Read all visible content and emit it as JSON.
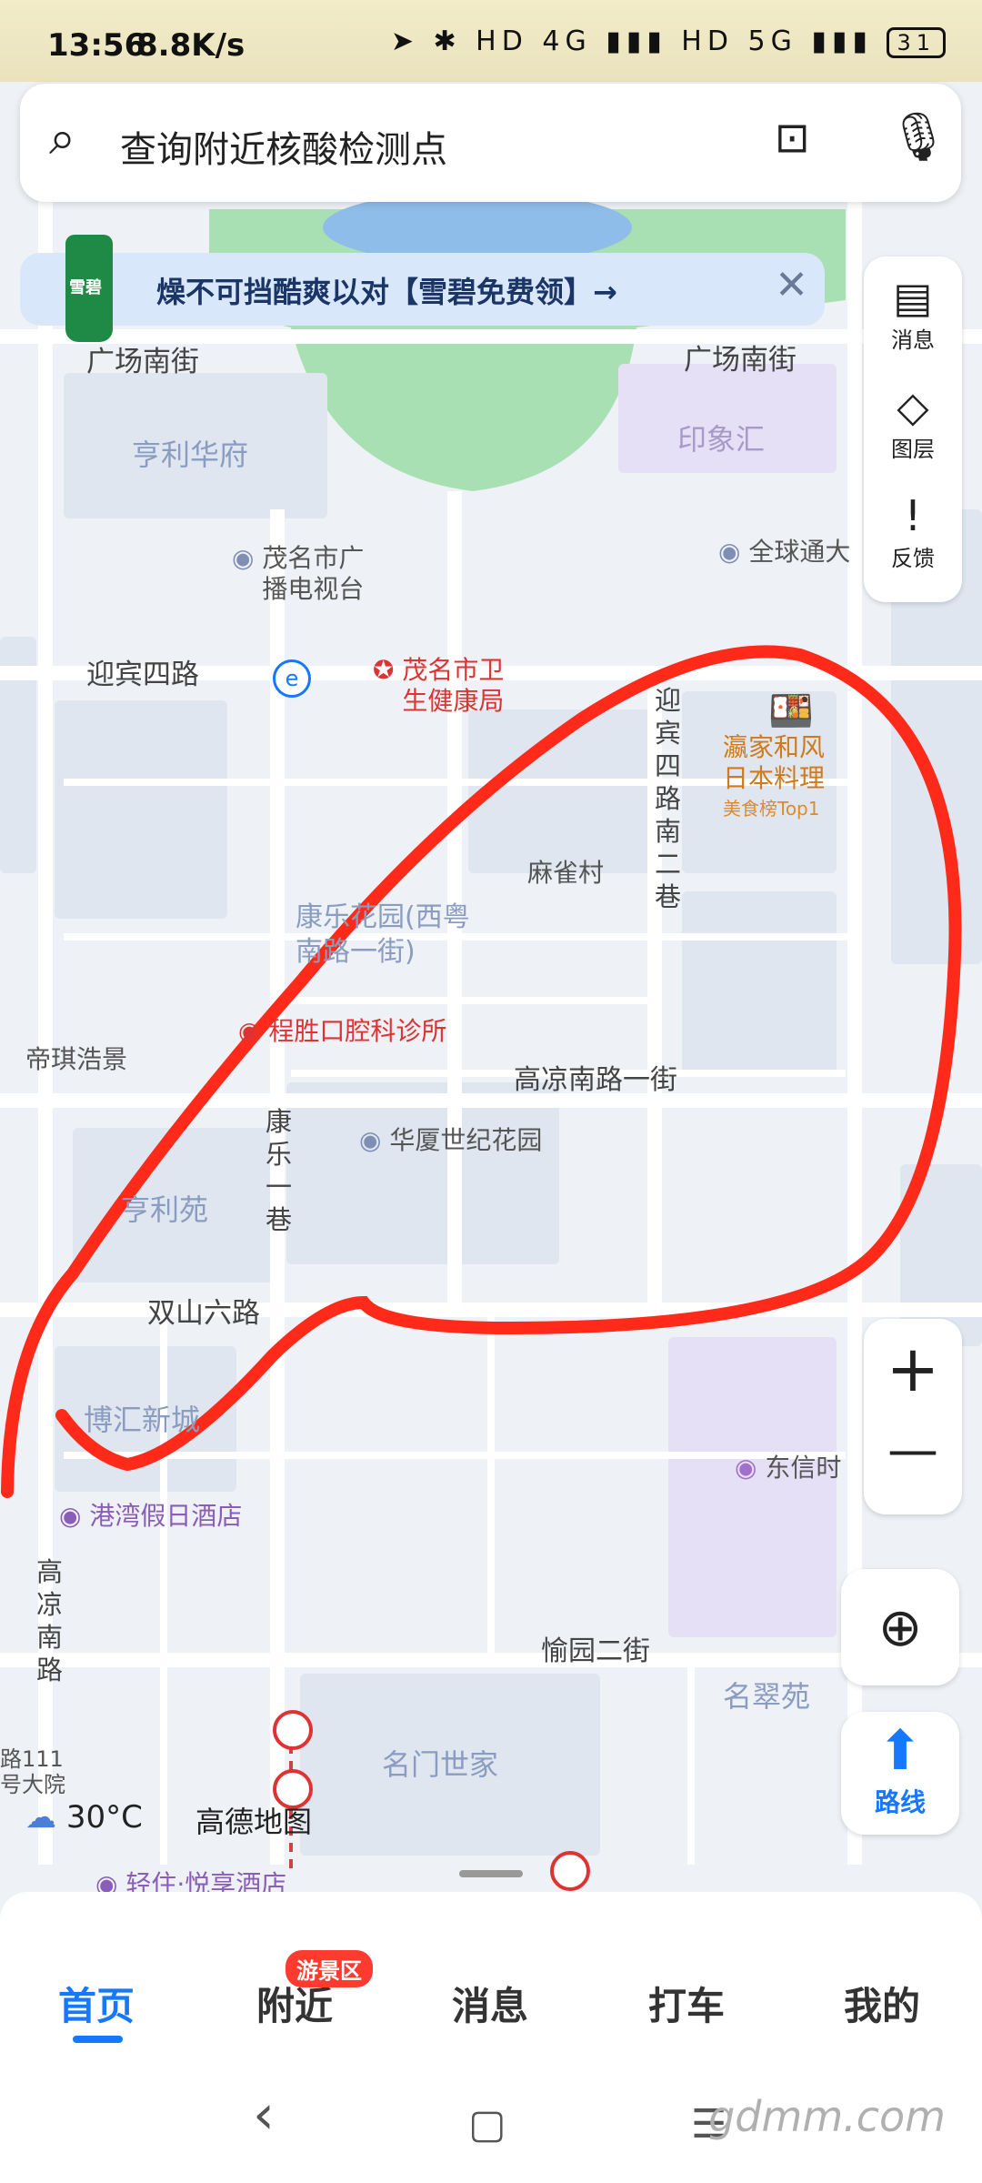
{
  "status_bar": {
    "time": "13:56",
    "speed": "8.8K/s",
    "icons_text": "➤ ✱ HD 4G ▮▮▮ HD 5G ▮▮▮",
    "battery": "31"
  },
  "search": {
    "placeholder": "查询附近核酸检测点",
    "search_icon": "search-icon",
    "scan_icon": "scan-icon",
    "mic_icon": "mic-icon"
  },
  "banner": {
    "text": "燥不可挡酷爽以对【雪碧免费领】→",
    "bottle_label": "雪碧"
  },
  "right_panel": [
    {
      "label": "消息",
      "icon": "message-icon"
    },
    {
      "label": "图层",
      "icon": "layers-icon"
    },
    {
      "label": "反馈",
      "icon": "feedback-icon"
    }
  ],
  "map_labels": {
    "street_1": "广场南街",
    "street_2": "广场南街",
    "street_3": "迎宾四路",
    "street_4": "高凉南路一街",
    "street_5": "双山六路",
    "street_6": "愉园二街",
    "street_7": "迎宾四路南二巷",
    "street_8": "康乐一巷",
    "street_9": "高凉南路",
    "area_1": "亨利华府",
    "area_2": "印象汇",
    "area_3": "康乐花园(西粤南路一街)",
    "area_4": "亨利苑",
    "area_5": "博汇新城",
    "area_6": "名翠苑",
    "area_7": "名门世家",
    "area_8": "麻雀村",
    "area_9": "帝琪浩景",
    "poi_tv": "茂名市广播电视台",
    "poi_health": "茂名市卫生健康局",
    "poi_global": "全球通大",
    "poi_restaurant": "瀛家和风日本料理",
    "poi_restaurant_tag": "美食榜Top1",
    "poi_clinic": "程胜口腔科诊所",
    "poi_huaxia": "华厦世纪花园",
    "poi_dongxin": "东信时",
    "poi_hotel": "港湾假日酒店",
    "poi_hotel2": "轻住·悦享酒店",
    "poi_hospital": "路111号大院"
  },
  "weather": "30°C",
  "brand": "高德地图",
  "zoom": {
    "plus": "+",
    "minus": "—"
  },
  "locate_icon": "locate-icon",
  "route": {
    "label": "路线",
    "icon": "route-arrow-icon"
  },
  "bottom_nav": {
    "tabs": [
      "首页",
      "附近",
      "消息",
      "打车",
      "我的"
    ],
    "badge": "游景区",
    "active": "首页"
  },
  "system_nav": {
    "back": "‹",
    "home": "▢",
    "menu": "☰"
  },
  "watermark": "gdmm.com",
  "colors": {
    "accent": "#1677ff",
    "annotation": "#ff2a1a",
    "park": "#a8dfb3"
  }
}
